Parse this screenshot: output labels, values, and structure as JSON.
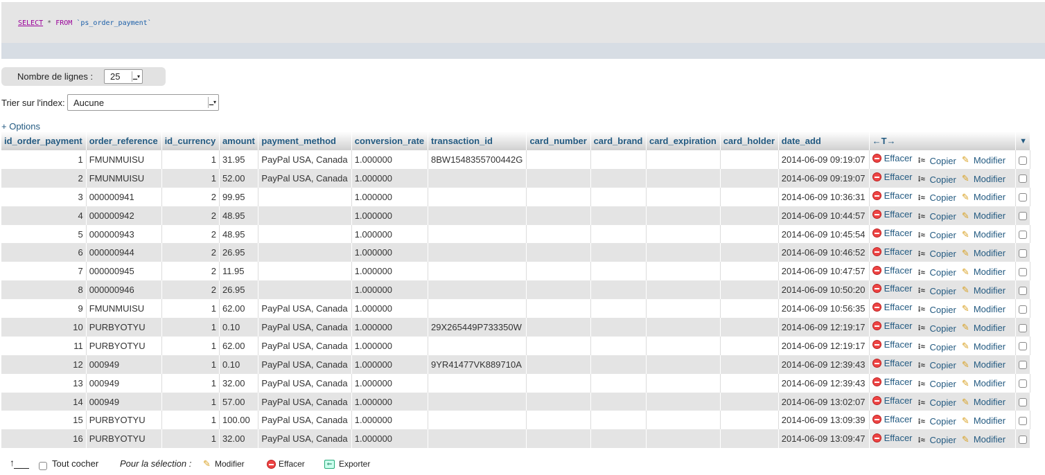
{
  "sql": {
    "select_kw": "SELECT",
    "star": "*",
    "from_kw": "FROM",
    "table": "`ps_order_payment`"
  },
  "rows_per_page": {
    "label": "Nombre de lignes :",
    "value": "25"
  },
  "sort": {
    "label": "Trier sur l'index:",
    "value": "Aucune"
  },
  "options_link": "+ Options",
  "table": {
    "columns": [
      "id_order_payment",
      "order_reference",
      "id_currency",
      "amount",
      "payment_method",
      "conversion_rate",
      "transaction_id",
      "card_number",
      "card_brand",
      "card_expiration",
      "card_holder",
      "date_add"
    ],
    "nav_header": "←T→",
    "menu_glyph": "▼",
    "actions": {
      "delete": "Effacer",
      "copy": "Copier",
      "edit": "Modifier"
    },
    "rows": [
      [
        "1",
        "FMUNMUISU",
        "1",
        "31.95",
        "PayPal USA, Canada",
        "1.000000",
        "8BW1548355700442G",
        "",
        "",
        "",
        "",
        "2014-06-09 09:19:07"
      ],
      [
        "2",
        "FMUNMUISU",
        "1",
        "52.00",
        "PayPal USA, Canada",
        "1.000000",
        "",
        "",
        "",
        "",
        "",
        "2014-06-09 09:19:07"
      ],
      [
        "3",
        "000000941",
        "2",
        "99.95",
        "",
        "1.000000",
        "",
        "",
        "",
        "",
        "",
        "2014-06-09 10:36:31"
      ],
      [
        "4",
        "000000942",
        "2",
        "48.95",
        "",
        "1.000000",
        "",
        "",
        "",
        "",
        "",
        "2014-06-09 10:44:57"
      ],
      [
        "5",
        "000000943",
        "2",
        "48.95",
        "",
        "1.000000",
        "",
        "",
        "",
        "",
        "",
        "2014-06-09 10:45:54"
      ],
      [
        "6",
        "000000944",
        "2",
        "26.95",
        "",
        "1.000000",
        "",
        "",
        "",
        "",
        "",
        "2014-06-09 10:46:52"
      ],
      [
        "7",
        "000000945",
        "2",
        "11.95",
        "",
        "1.000000",
        "",
        "",
        "",
        "",
        "",
        "2014-06-09 10:47:57"
      ],
      [
        "8",
        "000000946",
        "2",
        "26.95",
        "",
        "1.000000",
        "",
        "",
        "",
        "",
        "",
        "2014-06-09 10:50:20"
      ],
      [
        "9",
        "FMUNMUISU",
        "1",
        "62.00",
        "PayPal USA, Canada",
        "1.000000",
        "",
        "",
        "",
        "",
        "",
        "2014-06-09 10:56:35"
      ],
      [
        "10",
        "PURBYOTYU",
        "1",
        "0.10",
        "PayPal USA, Canada",
        "1.000000",
        "29X265449P733350W",
        "",
        "",
        "",
        "",
        "2014-06-09 12:19:17"
      ],
      [
        "11",
        "PURBYOTYU",
        "1",
        "62.00",
        "PayPal USA, Canada",
        "1.000000",
        "",
        "",
        "",
        "",
        "",
        "2014-06-09 12:19:17"
      ],
      [
        "12",
        "000949",
        "1",
        "0.10",
        "PayPal USA, Canada",
        "1.000000",
        "9YR41477VK889710A",
        "",
        "",
        "",
        "",
        "2014-06-09 12:39:43"
      ],
      [
        "13",
        "000949",
        "1",
        "32.00",
        "PayPal USA, Canada",
        "1.000000",
        "",
        "",
        "",
        "",
        "",
        "2014-06-09 12:39:43"
      ],
      [
        "14",
        "000949",
        "1",
        "57.00",
        "PayPal USA, Canada",
        "1.000000",
        "",
        "",
        "",
        "",
        "",
        "2014-06-09 13:02:07"
      ],
      [
        "15",
        "PURBYOTYU",
        "1",
        "100.00",
        "PayPal USA, Canada",
        "1.000000",
        "",
        "",
        "",
        "",
        "",
        "2014-06-09 13:09:39"
      ],
      [
        "16",
        "PURBYOTYU",
        "1",
        "32.00",
        "PayPal USA, Canada",
        "1.000000",
        "",
        "",
        "",
        "",
        "",
        "2014-06-09 13:09:47"
      ]
    ]
  },
  "bottom": {
    "check_all": "Tout cocher",
    "for_selection": "Pour la sélection :",
    "edit": "Modifier",
    "delete": "Effacer",
    "export": "Exporter"
  }
}
